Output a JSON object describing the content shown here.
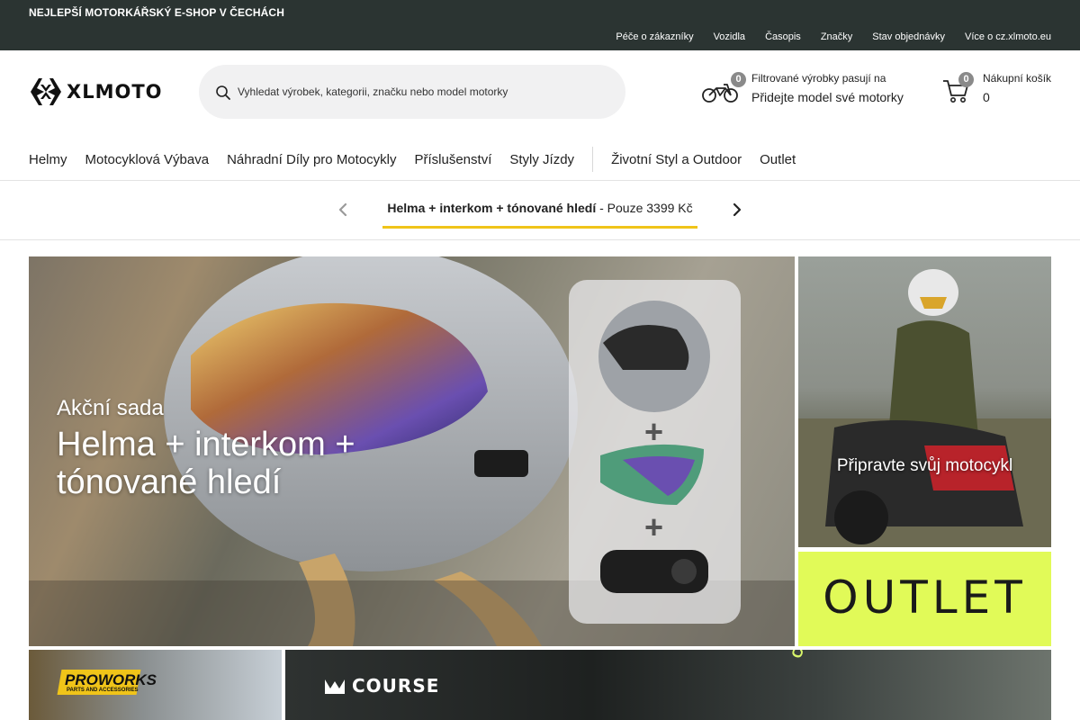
{
  "topbar": {
    "tagline": "NEJLEPŠÍ MOTORKÁŘSKÝ E-SHOP V ČECHÁCH",
    "links": [
      "Péče o zákazníky",
      "Vozidla",
      "Časopis",
      "Značky",
      "Stav objednávky",
      "Více o cz.xlmoto.eu"
    ]
  },
  "header": {
    "logo_text": "XLMOTO",
    "search_placeholder": "Vyhledat výrobek, kategorii, značku nebo model motorky",
    "garage": {
      "count": "0",
      "line1": "Filtrované výrobky pasují na",
      "line2": "Přidejte model své motorky"
    },
    "cart": {
      "count": "0",
      "line1": "Nákupní košík",
      "line2": "0"
    }
  },
  "nav": {
    "items": [
      "Helmy",
      "Motocyklová Výbava",
      "Náhradní Díly pro Motocykly",
      "Příslušenství",
      "Styly Jízdy"
    ],
    "items2": [
      "Životní Styl a Outdoor",
      "Outlet"
    ]
  },
  "promo": {
    "bold": "Helma + interkom + tónované hledí",
    "rest": " - Pouze 3399 Kč"
  },
  "banner": {
    "pre": "Akční sada",
    "title": "Helma + interkom + tónované hledí",
    "plus": "+"
  },
  "tiles": {
    "moto_caption": "Připravte svůj motocykl",
    "outlet_caption": "OUTLET",
    "proworks_text": "PROWORKS",
    "proworks_sub": "PARTS AND ACCESSORIES",
    "course_text": "COURSE",
    "course_side": "COURSE"
  },
  "colors": {
    "topbar": "#2b3432",
    "accent_yellow": "#f0c419",
    "outlet_green": "#e1fa58"
  }
}
